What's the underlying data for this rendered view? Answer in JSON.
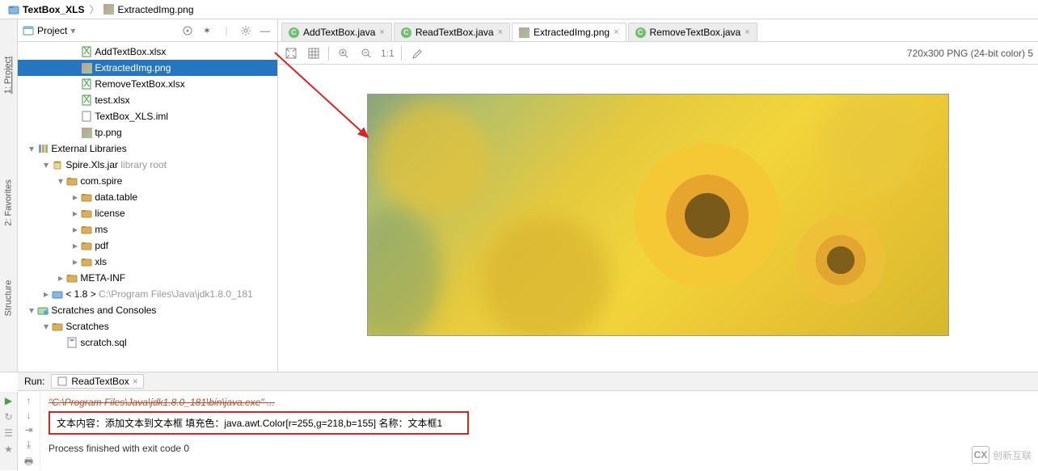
{
  "breadcrumb": {
    "root": "TextBox_XLS",
    "file": "ExtractedImg.png"
  },
  "sidebar": {
    "title": "Project",
    "tree": [
      {
        "indent": 3,
        "icon": "xlsx",
        "label": "AddTextBox.xlsx"
      },
      {
        "indent": 3,
        "icon": "img",
        "label": "ExtractedImg.png",
        "selected": true
      },
      {
        "indent": 3,
        "icon": "xlsx",
        "label": "RemoveTextBox.xlsx"
      },
      {
        "indent": 3,
        "icon": "xlsx",
        "label": "test.xlsx"
      },
      {
        "indent": 3,
        "icon": "iml",
        "label": "TextBox_XLS.iml"
      },
      {
        "indent": 3,
        "icon": "img",
        "label": "tp.png"
      },
      {
        "indent": 0,
        "arrow": "down",
        "icon": "lib",
        "label": "External Libraries"
      },
      {
        "indent": 1,
        "arrow": "down",
        "icon": "jar",
        "label": "Spire.Xls.jar",
        "suffix": "library root"
      },
      {
        "indent": 2,
        "arrow": "down",
        "icon": "folder",
        "label": "com.spire"
      },
      {
        "indent": 3,
        "arrow": "right",
        "icon": "folder",
        "label": "data.table"
      },
      {
        "indent": 3,
        "arrow": "right",
        "icon": "folder",
        "label": "license"
      },
      {
        "indent": 3,
        "arrow": "right",
        "icon": "folder",
        "label": "ms"
      },
      {
        "indent": 3,
        "arrow": "right",
        "icon": "folder",
        "label": "pdf"
      },
      {
        "indent": 3,
        "arrow": "right",
        "icon": "folder",
        "label": "xls"
      },
      {
        "indent": 2,
        "arrow": "right",
        "icon": "folder",
        "label": "META-INF"
      },
      {
        "indent": 1,
        "arrow": "right",
        "icon": "jdk",
        "label": "< 1.8 >",
        "suffix_gray": "C:\\Program Files\\Java\\jdk1.8.0_181"
      },
      {
        "indent": 0,
        "arrow": "down",
        "icon": "scratch",
        "label": "Scratches and Consoles"
      },
      {
        "indent": 1,
        "arrow": "down",
        "icon": "folder",
        "label": "Scratches"
      },
      {
        "indent": 2,
        "icon": "sql",
        "label": "scratch.sql"
      }
    ]
  },
  "tabs": [
    {
      "icon": "c",
      "label": "AddTextBox.java"
    },
    {
      "icon": "c",
      "label": "ReadTextBox.java"
    },
    {
      "icon": "img",
      "label": "ExtractedImg.png",
      "active": true
    },
    {
      "icon": "c",
      "label": "RemoveTextBox.java"
    }
  ],
  "image_info": "720x300 PNG (24-bit color) 5",
  "toolbar_ratio": "1:1",
  "run": {
    "label": "Run:",
    "config": "ReadTextBox",
    "cmd_line": "\"C:\\Program Files\\Java\\jdk1.8.0_181\\bin\\java.exe\" ...",
    "output": "文本内容：添加文本到文本框 填充色：java.awt.Color[r=255,g=218,b=155] 名称：文本框1",
    "finished": "Process finished with exit code 0"
  },
  "left_rail": {
    "project": "1: Project",
    "favorites": "2: Favorites",
    "structure": "Structure"
  },
  "watermark": "创新互联"
}
